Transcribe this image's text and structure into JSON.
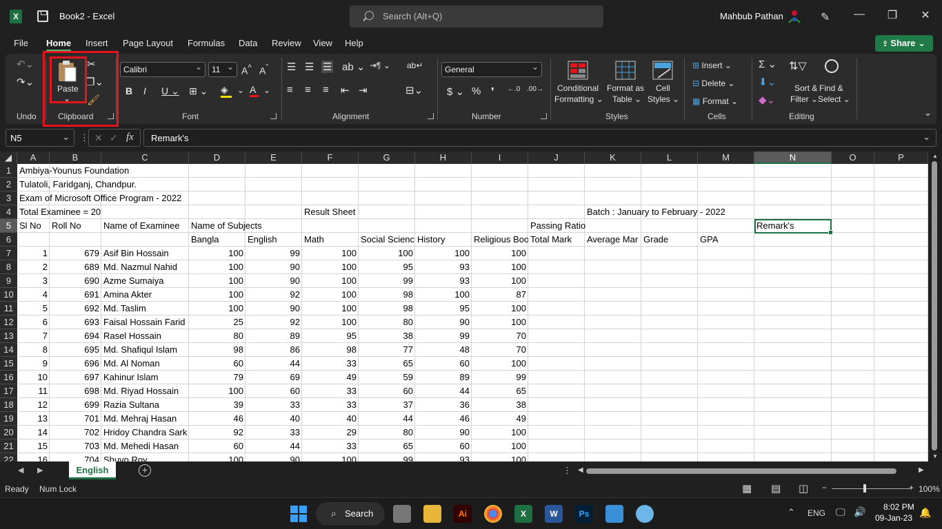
{
  "window": {
    "title": "Book2  -  Excel",
    "search_placeholder": "Search (Alt+Q)",
    "user_name": "Mahbub Pathan"
  },
  "menu": {
    "tabs": [
      "File",
      "Home",
      "Insert",
      "Page Layout",
      "Formulas",
      "Data",
      "Review",
      "View",
      "Help"
    ],
    "active": "Home",
    "share_label": "Share"
  },
  "ribbon": {
    "undo_label": "Undo",
    "clipboard_label": "Clipboard",
    "paste_label": "Paste",
    "font_label": "Font",
    "font_name": "Calibri",
    "font_size": "11",
    "alignment_label": "Alignment",
    "number_label": "Number",
    "number_format": "General",
    "styles_label": "Styles",
    "conditional_formatting_1": "Conditional",
    "conditional_formatting_2": "Formatting",
    "format_as_table_1": "Format as",
    "format_as_table_2": "Table",
    "cell_styles_1": "Cell",
    "cell_styles_2": "Styles",
    "cells_label": "Cells",
    "insert_label": "Insert",
    "delete_label": "Delete",
    "format_label": "Format",
    "editing_label": "Editing",
    "sort_filter_1": "Sort &",
    "sort_filter_2": "Filter",
    "find_select_1": "Find &",
    "find_select_2": "Select"
  },
  "formula_bar": {
    "name_box": "N5",
    "fx": "fx",
    "content": "Remark's"
  },
  "sheet": {
    "columns": [
      "A",
      "B",
      "C",
      "D",
      "E",
      "F",
      "G",
      "H",
      "I",
      "J",
      "K",
      "L",
      "M",
      "N",
      "O",
      "P"
    ],
    "rows": [
      "1",
      "2",
      "3",
      "4",
      "5",
      "6",
      "7",
      "8",
      "9",
      "10",
      "11",
      "12",
      "13",
      "14",
      "15",
      "16",
      "17",
      "18",
      "19",
      "20",
      "21",
      "22"
    ],
    "r1": "Ambiya-Younus Foundation",
    "r2": "Tulatoli, Faridganj, Chandpur.",
    "r3": "Exam of Microsoft Office Program - 2022",
    "r4a": "Total Examinee = 20",
    "r4f": "Result Sheet",
    "r4k": "Batch : January to February - 2022",
    "r5": [
      "Sl No",
      "Roll No",
      "Name of Examinee",
      "Name of Subjects",
      "Passing Ratio",
      "Remark's"
    ],
    "r6": [
      "Bangla",
      "English",
      "Math",
      "Social Scienc",
      "History",
      "Religious Boo",
      "Total Mark",
      "Average Mar",
      "Grade",
      "GPA"
    ],
    "data": [
      [
        "1",
        "679",
        "Asif Bin Hossain",
        "100",
        "99",
        "100",
        "100",
        "100",
        "100"
      ],
      [
        "2",
        "689",
        "Md. Nazmul Nahid",
        "100",
        "90",
        "100",
        "95",
        "93",
        "100"
      ],
      [
        "3",
        "690",
        "Azme Sumaiya",
        "100",
        "90",
        "100",
        "99",
        "93",
        "100"
      ],
      [
        "4",
        "691",
        "Amina Akter",
        "100",
        "92",
        "100",
        "98",
        "100",
        "87"
      ],
      [
        "5",
        "692",
        "Md. Taslim",
        "100",
        "90",
        "100",
        "98",
        "95",
        "100"
      ],
      [
        "6",
        "693",
        "Faisal Hossain Farid",
        "25",
        "92",
        "100",
        "80",
        "90",
        "100"
      ],
      [
        "7",
        "694",
        "Rasel Hossain",
        "80",
        "89",
        "95",
        "38",
        "99",
        "70"
      ],
      [
        "8",
        "695",
        "Md. Shafiqul Islam",
        "98",
        "86",
        "98",
        "77",
        "48",
        "70"
      ],
      [
        "9",
        "696",
        "Md. Al Noman",
        "60",
        "44",
        "33",
        "65",
        "60",
        "100"
      ],
      [
        "10",
        "697",
        "Kahinur Islam",
        "79",
        "69",
        "49",
        "59",
        "89",
        "99"
      ],
      [
        "11",
        "698",
        "Md. Riyad Hossain",
        "100",
        "60",
        "33",
        "60",
        "44",
        "65"
      ],
      [
        "12",
        "699",
        "Razia Sultana",
        "39",
        "33",
        "33",
        "37",
        "36",
        "38"
      ],
      [
        "13",
        "701",
        "Md. Mehraj Hasan",
        "46",
        "40",
        "40",
        "44",
        "46",
        "49"
      ],
      [
        "14",
        "702",
        "Hridoy Chandra Sark",
        "92",
        "33",
        "29",
        "80",
        "90",
        "100"
      ],
      [
        "15",
        "703",
        "Md. Mehedi Hasan",
        "60",
        "44",
        "33",
        "65",
        "60",
        "100"
      ],
      [
        "16",
        "704",
        "Shuvo Roy",
        "100",
        "90",
        "100",
        "99",
        "93",
        "100"
      ]
    ],
    "tab_name": "English"
  },
  "status": {
    "ready": "Ready",
    "numlock": "Num Lock",
    "zoom": "100%"
  },
  "taskbar": {
    "search_label": "Search",
    "lang": "ENG",
    "time": "8:02 PM",
    "date": "09-Jan-23"
  }
}
